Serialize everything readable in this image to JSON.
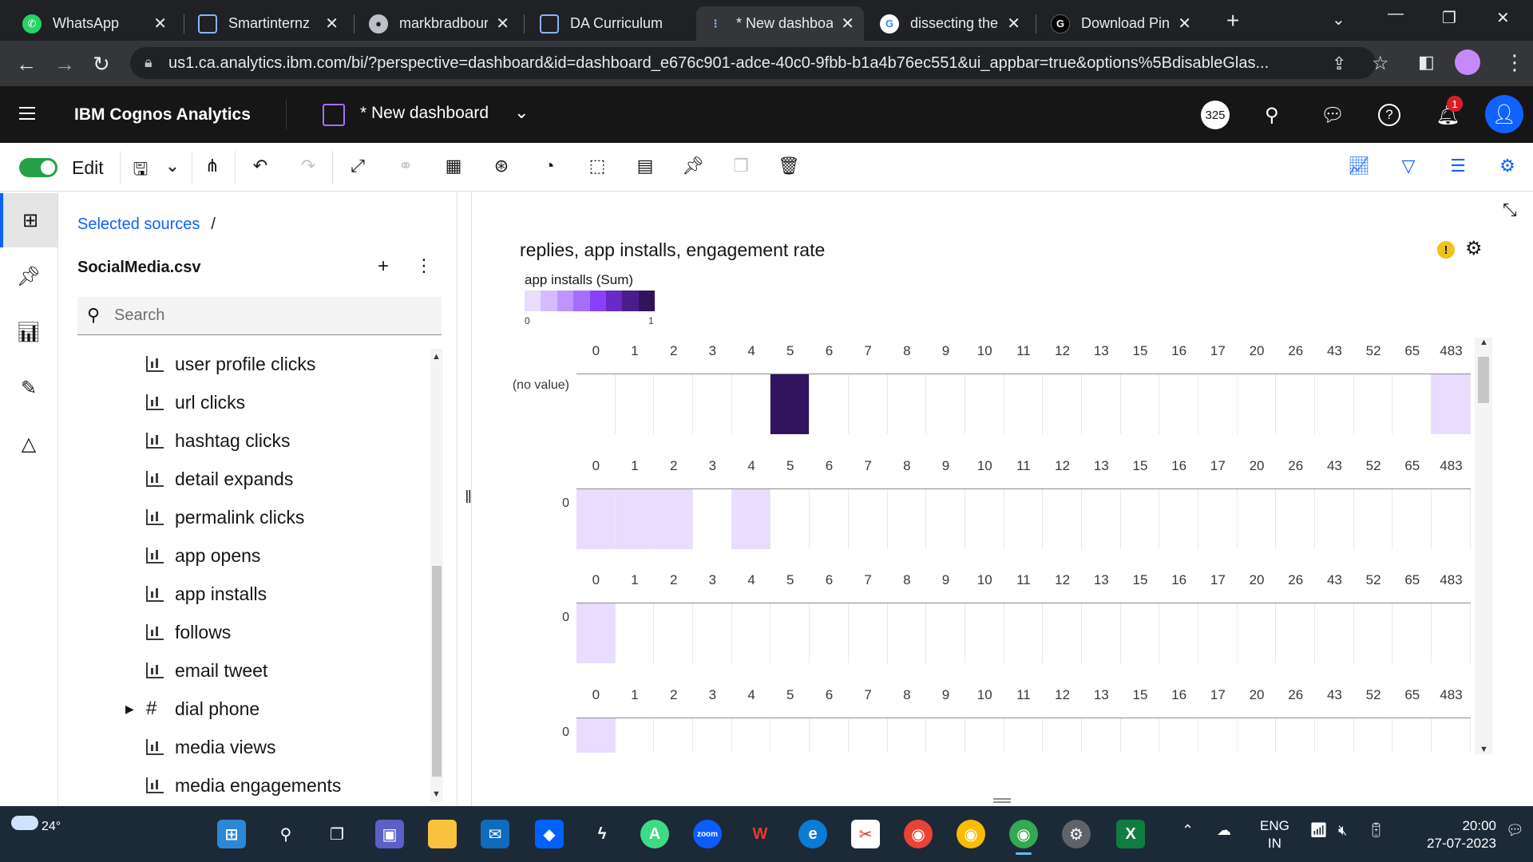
{
  "browser": {
    "tabs": [
      {
        "title": "WhatsApp",
        "icon": "whatsapp-icon",
        "color": "#25d366"
      },
      {
        "title": "Smartinternz",
        "icon": "page-icon",
        "color": "#5f6368"
      },
      {
        "title": "markbradbourn",
        "icon": "github-icon",
        "color": "#5f6368"
      },
      {
        "title": "DA Curriculum",
        "icon": "page-icon",
        "color": "#5f6368"
      },
      {
        "title": "* New dashboard",
        "icon": "cognos-icon",
        "color": "#4589ff",
        "active": true
      },
      {
        "title": "dissecting the c",
        "icon": "google-icon",
        "color": "#4285f4"
      },
      {
        "title": "Download Pinte",
        "icon": "g-icon",
        "color": "#000000"
      }
    ],
    "url": "us1.ca.analytics.ibm.com/bi/?perspective=dashboard&id=dashboard_e676c901-adce-40c0-9fbb-b1a4b76ec551&ui_appbar=true&options%5BdisableGlas..."
  },
  "app": {
    "brand": "IBM Cognos Analytics",
    "dashboard_title": "* New dashboard",
    "badge_count": "325",
    "notification_count": "1"
  },
  "toolbar": {
    "edit_label": "Edit"
  },
  "panel": {
    "breadcrumb_link": "Selected sources",
    "breadcrumb_sep": "/",
    "source_name": "SocialMedia.csv",
    "search_placeholder": "Search",
    "fields": [
      {
        "label": "user profile clicks",
        "type": "measure"
      },
      {
        "label": "url clicks",
        "type": "measure"
      },
      {
        "label": "hashtag clicks",
        "type": "measure"
      },
      {
        "label": "detail expands",
        "type": "measure"
      },
      {
        "label": "permalink clicks",
        "type": "measure"
      },
      {
        "label": "app opens",
        "type": "measure"
      },
      {
        "label": "app installs",
        "type": "measure"
      },
      {
        "label": "follows",
        "type": "measure"
      },
      {
        "label": "email tweet",
        "type": "measure"
      },
      {
        "label": "dial phone",
        "type": "identifier"
      },
      {
        "label": "media views",
        "type": "measure"
      },
      {
        "label": "media engagements",
        "type": "measure"
      }
    ]
  },
  "viz": {
    "title": "replies, app installs, engagement rate",
    "legend_title": "app installs (Sum)",
    "legend_min": "0",
    "legend_max": "1",
    "legend_colors": [
      "#e8dcff",
      "#d4bbff",
      "#be95ff",
      "#a56eff",
      "#8a3ffc",
      "#6929c4",
      "#491d8b",
      "#31135e"
    ]
  },
  "chart_data": {
    "type": "heatmap",
    "title": "replies, app installs, engagement rate",
    "color_label": "app installs (Sum)",
    "color_range": [
      0,
      1
    ],
    "columns": [
      "0",
      "1",
      "2",
      "3",
      "4",
      "5",
      "6",
      "7",
      "8",
      "9",
      "10",
      "11",
      "12",
      "13",
      "15",
      "16",
      "17",
      "20",
      "26",
      "43",
      "52",
      "65",
      "483"
    ],
    "rows": [
      {
        "label": "(no value)",
        "values": [
          null,
          null,
          null,
          null,
          null,
          1,
          null,
          null,
          null,
          null,
          null,
          null,
          null,
          null,
          null,
          null,
          null,
          null,
          null,
          null,
          null,
          null,
          0
        ]
      },
      {
        "label": "0",
        "values": [
          0,
          0,
          0,
          null,
          0,
          null,
          null,
          null,
          null,
          null,
          null,
          null,
          null,
          null,
          null,
          null,
          null,
          null,
          null,
          null,
          null,
          null,
          null
        ]
      },
      {
        "label": "0",
        "values": [
          0,
          null,
          null,
          null,
          null,
          null,
          null,
          null,
          null,
          null,
          null,
          null,
          null,
          null,
          null,
          null,
          null,
          null,
          null,
          null,
          null,
          null,
          null
        ]
      },
      {
        "label": "0",
        "values": [
          0,
          null,
          null,
          null,
          null,
          null,
          null,
          null,
          null,
          null,
          null,
          null,
          null,
          null,
          null,
          null,
          null,
          null,
          null,
          null,
          null,
          null,
          null
        ]
      }
    ],
    "low_color": "#e8dcff",
    "high_color": "#31135e"
  },
  "taskbar": {
    "temperature": "24°",
    "lang_line1": "ENG",
    "lang_line2": "IN",
    "time": "20:00",
    "date": "27-07-2023"
  }
}
